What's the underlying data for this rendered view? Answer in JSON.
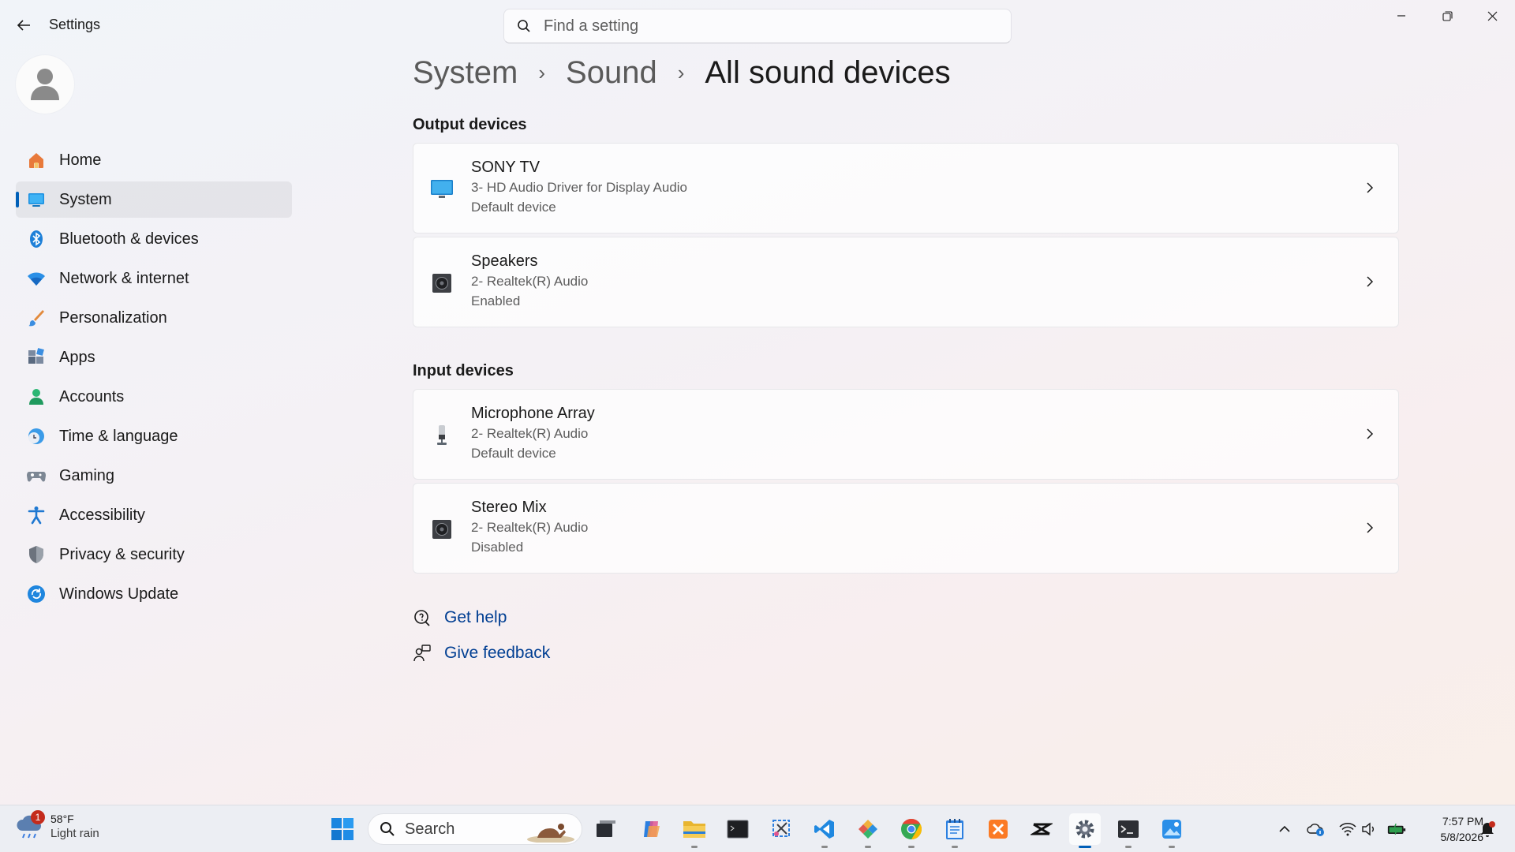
{
  "window": {
    "app_title": "Settings",
    "search_placeholder": "Find a setting",
    "search_value": ""
  },
  "sidebar": {
    "items": [
      {
        "label": "Home",
        "icon": "home-icon"
      },
      {
        "label": "System",
        "icon": "system-icon",
        "active": true
      },
      {
        "label": "Bluetooth & devices",
        "icon": "bluetooth-icon"
      },
      {
        "label": "Network & internet",
        "icon": "wifi-icon"
      },
      {
        "label": "Personalization",
        "icon": "brush-icon"
      },
      {
        "label": "Apps",
        "icon": "apps-icon"
      },
      {
        "label": "Accounts",
        "icon": "accounts-icon"
      },
      {
        "label": "Time & language",
        "icon": "clock-globe-icon"
      },
      {
        "label": "Gaming",
        "icon": "gamepad-icon"
      },
      {
        "label": "Accessibility",
        "icon": "accessibility-icon"
      },
      {
        "label": "Privacy & security",
        "icon": "shield-icon"
      },
      {
        "label": "Windows Update",
        "icon": "update-icon"
      }
    ]
  },
  "breadcrumb": {
    "items": [
      "System",
      "Sound"
    ],
    "current": "All sound devices"
  },
  "output_devices": {
    "title": "Output devices",
    "devices": [
      {
        "name": "SONY TV",
        "driver": "3- HD Audio Driver for Display Audio",
        "status": "Default device",
        "icon": "monitor-icon"
      },
      {
        "name": "Speakers",
        "driver": "2- Realtek(R) Audio",
        "status": "Enabled",
        "icon": "speaker-icon"
      }
    ]
  },
  "input_devices": {
    "title": "Input devices",
    "devices": [
      {
        "name": "Microphone Array",
        "driver": "2- Realtek(R) Audio",
        "status": "Default device",
        "icon": "microphone-icon"
      },
      {
        "name": "Stereo Mix",
        "driver": "2- Realtek(R) Audio",
        "status": "Disabled",
        "icon": "speaker-icon"
      }
    ]
  },
  "help": {
    "get_help": "Get help",
    "give_feedback": "Give feedback"
  },
  "taskbar": {
    "weather_temp": "58°F",
    "weather_condition": "Light rain",
    "weather_badge": "1",
    "search_label": "Search",
    "time": "7:57 PM",
    "date": "5/8/2026"
  },
  "colors": {
    "accent": "#005fb8",
    "link": "#003e92"
  }
}
